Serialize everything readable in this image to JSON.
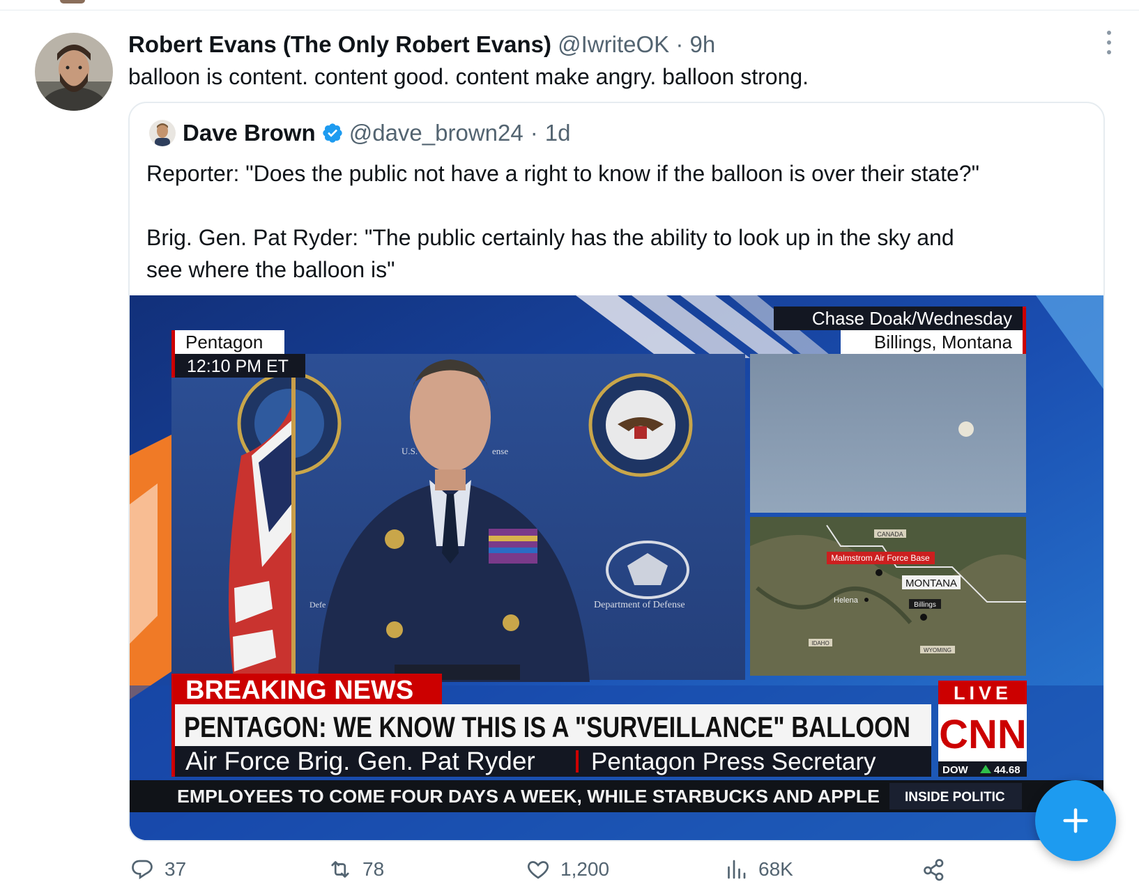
{
  "tweet": {
    "author_name": "Robert Evans (The Only Robert Evans)",
    "handle": "@IwriteOK",
    "separator": "·",
    "time": "9h",
    "text": "balloon is content. content good. content make angry. balloon strong."
  },
  "quoted_tweet": {
    "author_name": "Dave Brown",
    "verified": true,
    "handle": "@dave_brown24",
    "separator": "·",
    "time": "1d",
    "text_lines": [
      "Reporter: \"Does the public not have a right to know if the balloon is over their state?\"",
      "Brig. Gen. Pat Ryder: \"The public certainly has the ability to look up in the sky and",
      "see where the balloon is\""
    ]
  },
  "media": {
    "location": "Pentagon",
    "timestamp": "12:10 PM ET",
    "credit_line1": "Chase Doak/Wednesday",
    "credit_line2": "Billings, Montana",
    "backdrop_text_left": "U.S.",
    "backdrop_text_right": "ense",
    "backdrop_defe": "Defe",
    "backdrop_dept": "Department of Defense",
    "map_labels": {
      "canada": "CANADA",
      "base": "Malmstrom Air Force Base",
      "state": "MONTANA",
      "helena": "Helena",
      "billings": "Billings",
      "idaho": "IDAHO",
      "wyoming": "WYOMING"
    },
    "breaking": "BREAKING NEWS",
    "headline": "PENTAGON: WE KNOW THIS IS A \"SURVEILLANCE\" BALLOON",
    "speaker": "Air Force Brig. Gen. Pat Ryder",
    "speaker_title": "Pentagon Press Secretary",
    "live": "LIVE",
    "network": "CNN",
    "dow_label": "DOW",
    "dow_value": "44.68",
    "ticker": "EMPLOYEES TO COME FOUR DAYS A WEEK, WHILE STARBUCKS AND APPLE",
    "show": "INSIDE POLITIC"
  },
  "actions": {
    "replies": "37",
    "retweets": "78",
    "likes": "1,200",
    "views": "68K"
  },
  "icons": [
    "more-icon",
    "verified-icon",
    "reply-icon",
    "retweet-icon",
    "like-icon",
    "views-icon",
    "share-icon",
    "compose-plus-icon"
  ],
  "colors": {
    "text_primary": "#0f1419",
    "text_secondary": "#536471",
    "accent": "#1d9bf0",
    "cnn_red": "#cc0000"
  }
}
